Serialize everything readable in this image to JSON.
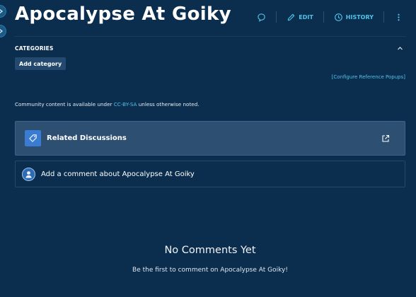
{
  "page": {
    "title": "Apocalypse At Goiky"
  },
  "actions": {
    "edit_label": "EDIT",
    "history_label": "HISTORY"
  },
  "categories": {
    "heading": "CATEGORIES",
    "add_label": "Add category",
    "ref_popups_label": "[Configure Reference Popups]"
  },
  "license": {
    "prefix": "Community content is available under ",
    "link_text": "CC-BY-SA",
    "suffix": " unless otherwise noted."
  },
  "related": {
    "label": "Related Discussions"
  },
  "comment": {
    "prompt": "Add a comment about Apocalypse At Goiky"
  },
  "empty_state": {
    "title": "No Comments Yet",
    "subtitle": "Be the first to comment on Apocalypse At Goiky!"
  },
  "icons": {
    "rail_top": "chevron-right-icon",
    "rail_bottom": "chevron-right-icon",
    "talk": "speech-bubble-icon",
    "edit": "pencil-icon",
    "history": "clock-icon",
    "more": "vertical-dots-icon",
    "collapse": "chevron-up-icon",
    "related": "tag-icon",
    "external": "external-link-icon",
    "avatar": "user-avatar-icon"
  },
  "colors": {
    "background": "#0b2e4f",
    "accent": "#4fc3e8",
    "panel": "#2d4f72",
    "tag_blue": "#3a7cd4"
  }
}
